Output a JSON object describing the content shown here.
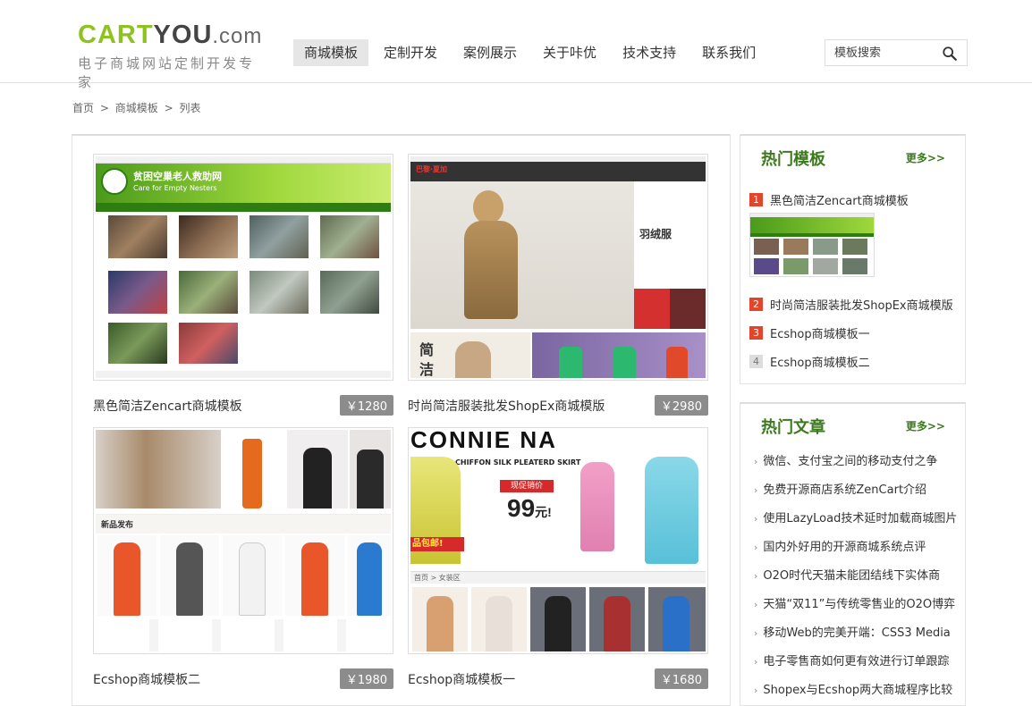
{
  "header": {
    "logo_cart": "CART",
    "logo_you": "YOU",
    "logo_domain": ".com",
    "logo_tagline": "电子商城网站定制开发专家",
    "nav": [
      "商城模板",
      "定制开发",
      "案例展示",
      "关于咔优",
      "技术支持",
      "联系我们"
    ],
    "search_placeholder": "模板搜索"
  },
  "breadcrumb": [
    "首页",
    ">",
    "商城模板",
    ">",
    "列表"
  ],
  "products": [
    {
      "title": "黑色简洁Zencart商城模板",
      "price": "￥1280"
    },
    {
      "title": "时尚简洁服装批发ShopEx商城模版",
      "price": "￥2980"
    },
    {
      "title": "Ecshop商城模板二",
      "price": "￥1980"
    },
    {
      "title": "Ecshop商城模板一",
      "price": "￥1680"
    }
  ],
  "thumb_text": {
    "t1_banner": "贫困空巢老人救助网",
    "t1_banner_en": "Care for Empty Nesters",
    "t2_brand": "巴黎·夏加",
    "t2_label": "羽绒服",
    "t2_jp": "简",
    "t2_jp2": "洁",
    "t3_label": "新品发布",
    "t4_brand": "CONNIE NA",
    "t4_sub": "CHIFFON SILK PLEATERD SKIRT",
    "t4_price": "99",
    "t4_unit": "元!",
    "t4_promo": "现促销价",
    "t4_ship": "品包邮!",
    "t4_cat": "首页 > 女装区"
  },
  "sidebar": {
    "hot_templates": {
      "title": "热门模板",
      "more": "更多>>",
      "items": [
        {
          "num": "1",
          "label": "黑色简洁Zencart商城模板"
        },
        {
          "num": "2",
          "label": "时尚简洁服装批发ShopEx商城模版"
        },
        {
          "num": "3",
          "label": "Ecshop商城模板一"
        },
        {
          "num": "4",
          "label": "Ecshop商城模板二"
        }
      ]
    },
    "hot_articles": {
      "title": "热门文章",
      "more": "更多>>",
      "items": [
        "微信、支付宝之间的移动支付之争",
        "免费开源商店系统ZenCart介绍",
        "使用LazyLoad技术延时加载商城图片",
        "国内外好用的开源商城系统点评",
        "O2O时代天猫未能团结线下实体商",
        "天猫“双11”与传统零售业的O2O博弈",
        "移动Web的完美开端：CSS3 Media",
        "电子零售商如何更有效进行订单跟踪",
        "Shopex与Ecshop两大商城程序比较"
      ]
    }
  }
}
